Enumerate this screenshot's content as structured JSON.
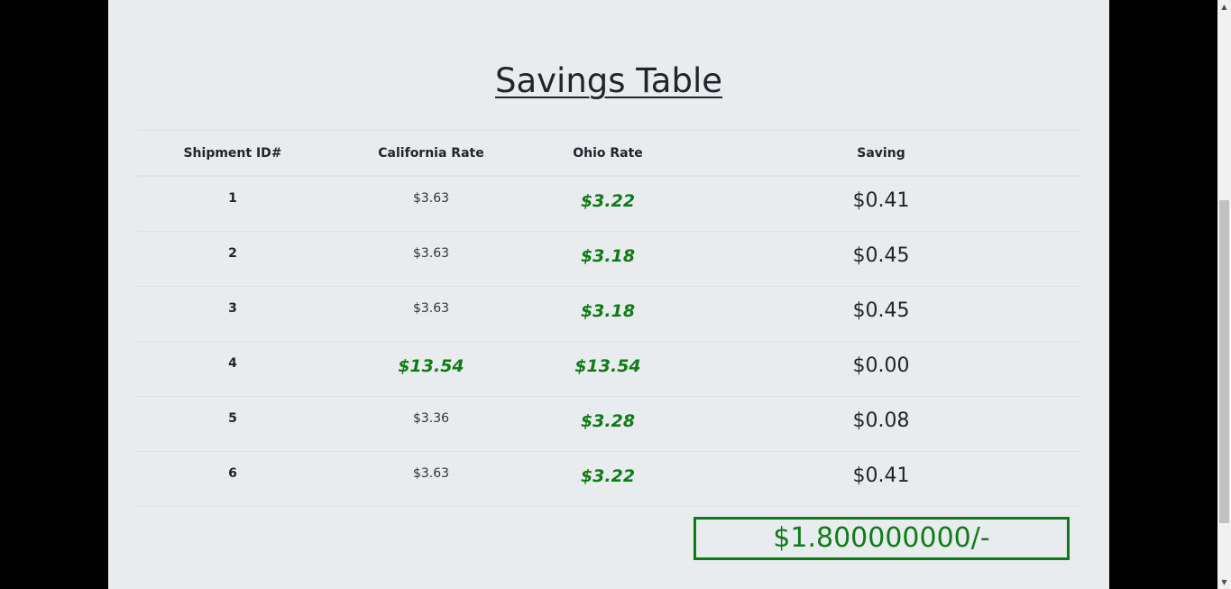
{
  "page": {
    "title": "Savings Table"
  },
  "table": {
    "headers": {
      "id": "Shipment ID#",
      "california": "California Rate",
      "ohio": "Ohio Rate",
      "saving": "Saving"
    },
    "rows": [
      {
        "id": "1",
        "california": "$3.63",
        "ohio": "$3.22",
        "saving": "$0.41"
      },
      {
        "id": "2",
        "california": "$3.63",
        "ohio": "$3.18",
        "saving": "$0.45"
      },
      {
        "id": "3",
        "california": "$3.63",
        "ohio": "$3.18",
        "saving": "$0.45"
      },
      {
        "id": "4",
        "california": "$13.54",
        "ohio": "$13.54",
        "saving": "$0.00"
      },
      {
        "id": "5",
        "california": "$3.36",
        "ohio": "$3.28",
        "saving": "$0.08"
      },
      {
        "id": "6",
        "california": "$3.63",
        "ohio": "$3.22",
        "saving": "$0.41"
      }
    ]
  },
  "total": {
    "label": "$1.800000000/-"
  },
  "colors": {
    "best_rate": "#0f7b16",
    "card_background": "#e9ecef",
    "page_background": "#000000"
  },
  "scrollbar": {
    "up_arrow_icon": "▲",
    "down_arrow_icon": "▼"
  }
}
